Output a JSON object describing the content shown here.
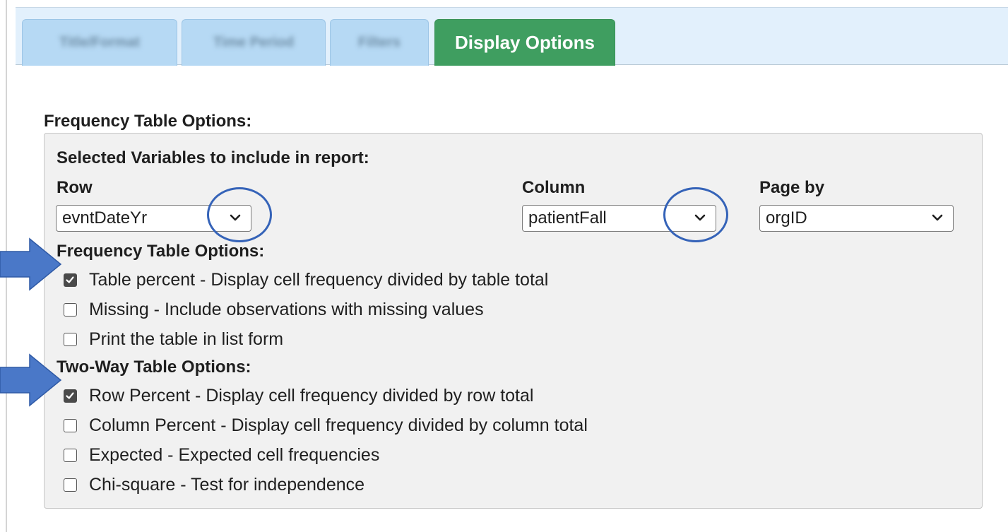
{
  "tabs": [
    {
      "label": "Title/Format",
      "active": false
    },
    {
      "label": "Time Period",
      "active": false
    },
    {
      "label": "Filters",
      "active": false
    },
    {
      "label": "Display Options",
      "active": true
    }
  ],
  "section_title": "Frequency Table Options:",
  "panel": {
    "heading": "Selected Variables to include in report:",
    "row_label": "Row",
    "row_value": "evntDateYr",
    "column_label": "Column",
    "column_value": "patientFall",
    "pageby_label": "Page by",
    "pageby_value": "orgID",
    "freq_heading": "Frequency Table Options:",
    "freq_options": [
      {
        "label": "Table percent - Display cell frequency divided by table total",
        "checked": true
      },
      {
        "label": "Missing - Include observations with missing values",
        "checked": false
      },
      {
        "label": "Print the table in list form",
        "checked": false
      }
    ],
    "twoway_heading": "Two-Way Table Options:",
    "twoway_options": [
      {
        "label": "Row Percent - Display cell frequency divided by row total",
        "checked": true
      },
      {
        "label": "Column Percent - Display cell frequency divided by column total",
        "checked": false
      },
      {
        "label": "Expected - Expected cell frequencies",
        "checked": false
      },
      {
        "label": "Chi-square - Test for independence",
        "checked": false
      }
    ]
  },
  "colors": {
    "active_tab": "#3f9e60",
    "inactive_tab": "#b6d9f4",
    "tabbar": "#e2f0fc",
    "annotation": "#3563b8",
    "arrow": "#4a78c8"
  }
}
